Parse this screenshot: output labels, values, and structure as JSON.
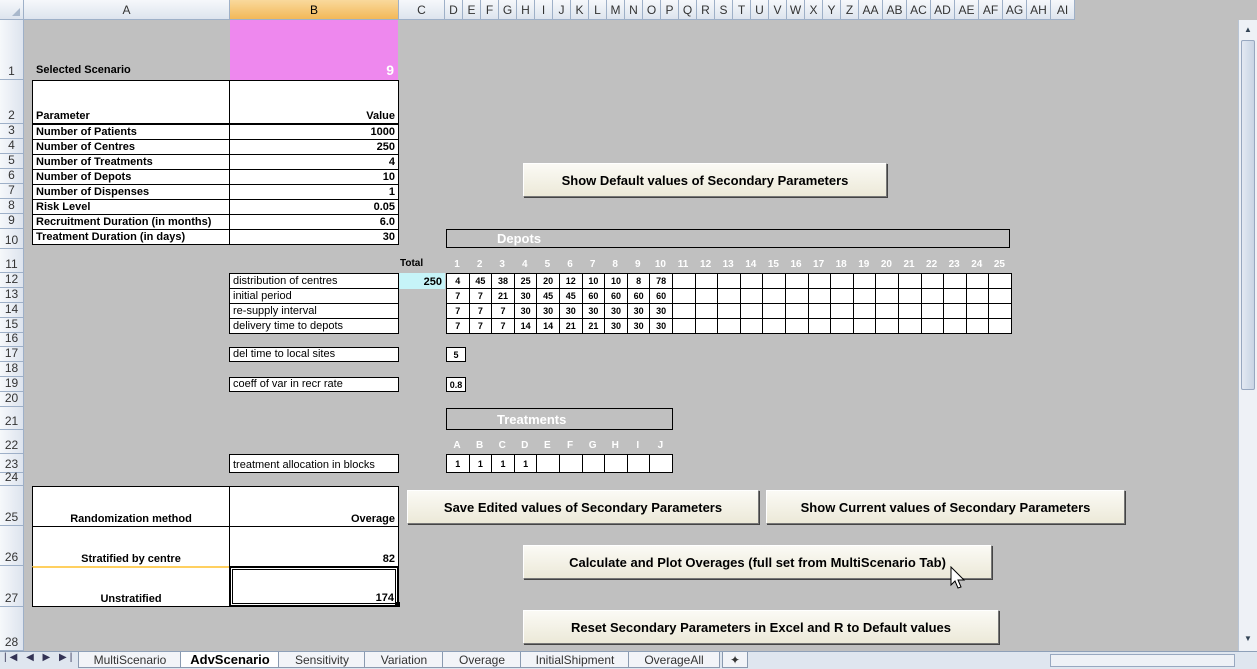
{
  "columns": [
    "A",
    "B",
    "C",
    "D",
    "E",
    "F",
    "G",
    "H",
    "I",
    "J",
    "K",
    "L",
    "M",
    "N",
    "O",
    "P",
    "Q",
    "R",
    "S",
    "T",
    "U",
    "V",
    "W",
    "X",
    "Y",
    "Z",
    "AA",
    "AB",
    "AC",
    "AD",
    "AE",
    "AF",
    "AG",
    "AH",
    "AI"
  ],
  "rows": [
    "1",
    "2",
    "3",
    "4",
    "5",
    "6",
    "7",
    "8",
    "9",
    "10",
    "11",
    "12",
    "13",
    "14",
    "15",
    "16",
    "17",
    "18",
    "19",
    "20",
    "21",
    "22",
    "23",
    "24",
    "25",
    "26",
    "27",
    "28"
  ],
  "scenario": {
    "label": "Selected Scenario",
    "value": "9"
  },
  "params": {
    "header_label": "Parameter",
    "header_value": "Value",
    "items": [
      {
        "label": "Number of Patients",
        "value": "1000"
      },
      {
        "label": "Number of Centres",
        "value": "250"
      },
      {
        "label": "Number of Treatments",
        "value": "4"
      },
      {
        "label": "Number of Depots",
        "value": "10"
      },
      {
        "label": "Number of Dispenses",
        "value": "1"
      },
      {
        "label": "Risk Level",
        "value": "0.05"
      },
      {
        "label": "Recruitment Duration (in months)",
        "value": "6.0"
      },
      {
        "label": "Treatment Duration (in days)",
        "value": "30"
      }
    ]
  },
  "depots": {
    "title": "Depots",
    "total_label": "Total",
    "numbers": [
      "1",
      "2",
      "3",
      "4",
      "5",
      "6",
      "7",
      "8",
      "9",
      "10",
      "11",
      "12",
      "13",
      "14",
      "15",
      "16",
      "17",
      "18",
      "19",
      "20",
      "21",
      "22",
      "23",
      "24",
      "25"
    ],
    "rows": [
      {
        "label": "distribution of centres",
        "total": "250",
        "values": [
          "4",
          "45",
          "38",
          "25",
          "20",
          "12",
          "10",
          "10",
          "8",
          "78"
        ]
      },
      {
        "label": "initial period",
        "total": "",
        "values": [
          "7",
          "7",
          "21",
          "30",
          "45",
          "45",
          "60",
          "60",
          "60",
          "60"
        ]
      },
      {
        "label": "re-supply interval",
        "total": "",
        "values": [
          "7",
          "7",
          "7",
          "30",
          "30",
          "30",
          "30",
          "30",
          "30",
          "30"
        ]
      },
      {
        "label": "delivery time to depots",
        "total": "",
        "values": [
          "7",
          "7",
          "7",
          "14",
          "14",
          "21",
          "21",
          "30",
          "30",
          "30"
        ]
      }
    ]
  },
  "del_time": {
    "label": "del time to local sites",
    "value": "5"
  },
  "coeff": {
    "label": "coeff of var in recr rate",
    "value": "0.8"
  },
  "treatments": {
    "title": "Treatments",
    "letters": [
      "A",
      "B",
      "C",
      "D",
      "E",
      "F",
      "G",
      "H",
      "I",
      "J"
    ],
    "label": "treatment allocation in blocks",
    "values": [
      "1",
      "1",
      "1",
      "1",
      "",
      "",
      "",
      "",
      "",
      ""
    ]
  },
  "randomization": {
    "header_label": "Randomization method",
    "header_value": "Overage",
    "rows": [
      {
        "label": "Stratified by centre",
        "value": "82"
      },
      {
        "label": "Unstratified",
        "value": "174"
      }
    ]
  },
  "buttons": {
    "show_default": "Show Default values of Secondary Parameters",
    "save_edited": "Save Edited values of Secondary Parameters",
    "show_current": "Show Current values of Secondary Parameters",
    "calculate": "Calculate and Plot Overages (full set from MultiScenario Tab)",
    "reset": "Reset Secondary Parameters in Excel and R to Default values"
  },
  "tabs": [
    "MultiScenario",
    "AdvScenario",
    "Sensitivity",
    "Variation",
    "Overage",
    "InitialShipment",
    "OverageAll"
  ],
  "active_tab": "AdvScenario",
  "colors": {
    "scenario_bg": "#ee88ee",
    "total_bg": "#c6f4f8",
    "sheet_bg": "#c0c0c0"
  }
}
